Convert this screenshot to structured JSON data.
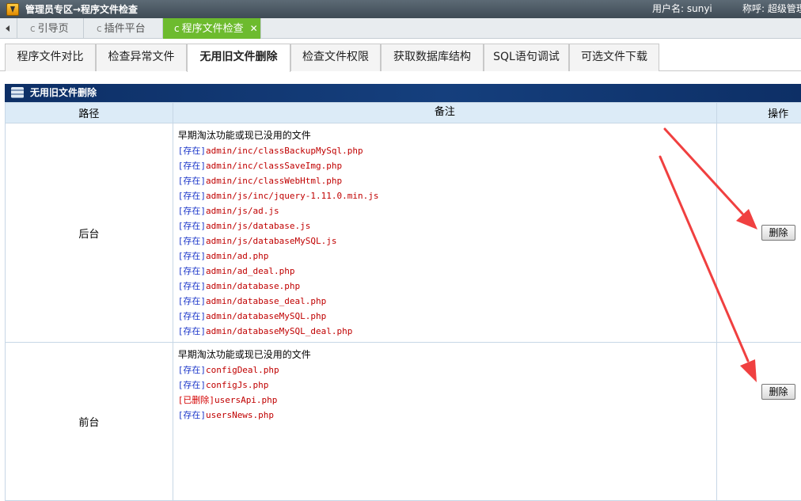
{
  "topbar": {
    "icon": "download-arrow-icon",
    "title": "管理员专区→程序文件检查",
    "user_text": "用户名: sunyi",
    "nick_text": "称呼: 超级管理"
  },
  "page_tabs": [
    {
      "label": "引导页",
      "icon": "refresh-icon",
      "closable": false,
      "active": false
    },
    {
      "label": "插件平台",
      "icon": "refresh-icon",
      "closable": true,
      "active": false
    },
    {
      "label": "程序文件检查",
      "icon": "refresh-icon",
      "closable": true,
      "active": true
    }
  ],
  "func_tabs": [
    {
      "label": "程序文件对比",
      "active": false
    },
    {
      "label": "检查异常文件",
      "active": false
    },
    {
      "label": "无用旧文件删除",
      "active": true
    },
    {
      "label": "检查文件权限",
      "active": false
    },
    {
      "label": "获取数据库结构",
      "active": false
    },
    {
      "label": "SQL语句调试",
      "active": false
    },
    {
      "label": "可选文件下载",
      "active": false
    }
  ],
  "panel": {
    "title": "无用旧文件删除",
    "columns": [
      "路径",
      "备注",
      "操作"
    ]
  },
  "rows": [
    {
      "path": "后台",
      "note_title": "早期淘汰功能或现已没用的文件",
      "files": [
        {
          "status": "[存在]",
          "name": "admin/inc/classBackupMySql.php"
        },
        {
          "status": "[存在]",
          "name": "admin/inc/classSaveImg.php"
        },
        {
          "status": "[存在]",
          "name": "admin/inc/classWebHtml.php"
        },
        {
          "status": "[存在]",
          "name": "admin/js/inc/jquery-1.11.0.min.js"
        },
        {
          "status": "[存在]",
          "name": "admin/js/ad.js"
        },
        {
          "status": "[存在]",
          "name": "admin/js/database.js"
        },
        {
          "status": "[存在]",
          "name": "admin/js/databaseMySQL.js"
        },
        {
          "status": "[存在]",
          "name": "admin/ad.php"
        },
        {
          "status": "[存在]",
          "name": "admin/ad_deal.php"
        },
        {
          "status": "[存在]",
          "name": "admin/database.php"
        },
        {
          "status": "[存在]",
          "name": "admin/database_deal.php"
        },
        {
          "status": "[存在]",
          "name": "admin/databaseMySQL.php"
        },
        {
          "status": "[存在]",
          "name": "admin/databaseMySQL_deal.php"
        }
      ],
      "button": "删除"
    },
    {
      "path": "前台",
      "note_title": "早期淘汰功能或现已没用的文件",
      "files": [
        {
          "status": "[存在]",
          "name": "configDeal.php"
        },
        {
          "status": "[存在]",
          "name": "configJs.php"
        },
        {
          "status": "[已删除]",
          "name": "usersApi.php"
        },
        {
          "status": "[存在]",
          "name": "usersNews.php"
        }
      ],
      "button": "删除"
    }
  ],
  "colors": {
    "exists_status": "#1a35c9",
    "deleted_status": "#d40000",
    "filename": "#c00000",
    "active_page_tab": "#6dbb2e",
    "panel_header": "#0d2f66",
    "annotation_arrow": "#f04040"
  }
}
